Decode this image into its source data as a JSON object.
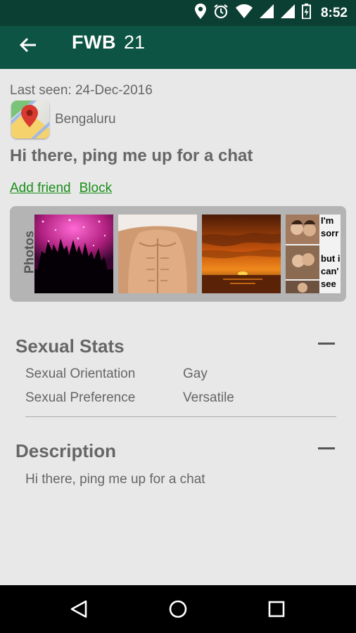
{
  "status_bar": {
    "time": "8:52",
    "icons": [
      "location-icon",
      "alarm-icon",
      "wifi-icon",
      "signal-icon",
      "signal-icon",
      "battery-icon"
    ]
  },
  "app_bar": {
    "back_icon": "arrow-back-icon",
    "title": "FWB",
    "age": "21"
  },
  "profile": {
    "last_seen": "Last seen: 24-Dec-2016",
    "location_icon": "google-maps-icon",
    "city": "Bengaluru",
    "status_message": "Hi there, ping me up for a chat",
    "actions": {
      "add_friend": "Add friend",
      "block": "Block"
    },
    "photos_label": "Photos",
    "photos": [
      {
        "name": "photo-party"
      },
      {
        "name": "photo-torso"
      },
      {
        "name": "photo-sunset"
      },
      {
        "name": "photo-collage",
        "text": [
          "I'm",
          "sorr",
          "but i",
          "can'",
          "see t"
        ]
      }
    ]
  },
  "sexual_stats": {
    "title": "Sexual Stats",
    "rows": [
      {
        "label": "Sexual Orientation",
        "value": "Gay"
      },
      {
        "label": "Sexual Preference",
        "value": "Versatile"
      }
    ]
  },
  "description": {
    "title": "Description",
    "text": "Hi there, ping me up for a chat"
  },
  "nav_bar": {
    "buttons": [
      "back-triangle-icon",
      "home-circle-icon",
      "recents-square-icon"
    ]
  },
  "colors": {
    "status_bar": "#0c3f33",
    "app_bar": "#0d5444",
    "link_green": "#1a8e1a",
    "background": "#e8e8e8"
  }
}
